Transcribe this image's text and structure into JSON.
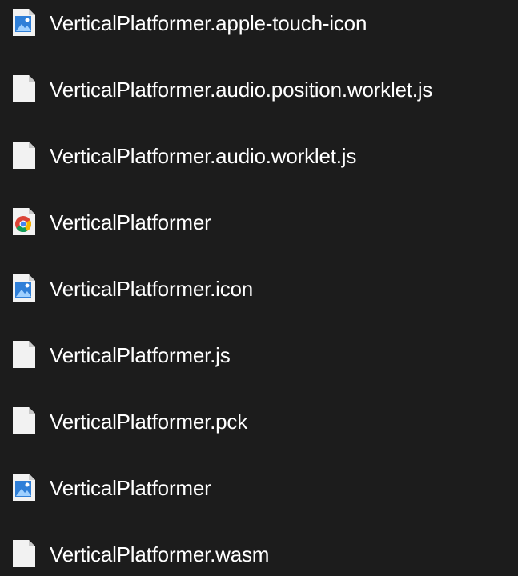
{
  "file_list": {
    "items": [
      {
        "name": "VerticalPlatformer.apple-touch-icon",
        "icon": "image-file-icon"
      },
      {
        "name": "VerticalPlatformer.audio.position.worklet.js",
        "icon": "generic-file-icon"
      },
      {
        "name": "VerticalPlatformer.audio.worklet.js",
        "icon": "generic-file-icon"
      },
      {
        "name": "VerticalPlatformer",
        "icon": "chrome-html-file-icon"
      },
      {
        "name": "VerticalPlatformer.icon",
        "icon": "image-file-icon"
      },
      {
        "name": "VerticalPlatformer.js",
        "icon": "generic-file-icon"
      },
      {
        "name": "VerticalPlatformer.pck",
        "icon": "generic-file-icon"
      },
      {
        "name": "VerticalPlatformer",
        "icon": "image-file-icon"
      },
      {
        "name": "VerticalPlatformer.wasm",
        "icon": "generic-file-icon"
      }
    ]
  },
  "colors": {
    "background": "#1c1c1c",
    "text": "#ffffff",
    "file_icon": "#f2f2f2",
    "image_icon_blue": "#2f7fd8"
  }
}
